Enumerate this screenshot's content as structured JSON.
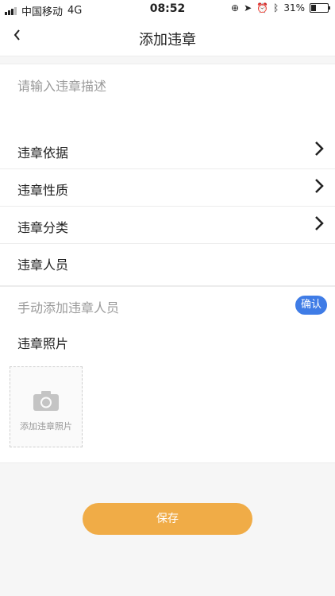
{
  "status_bar": {
    "carrier": "中国移动",
    "network": "4G",
    "time": "08:52",
    "battery_percent": "31%"
  },
  "nav": {
    "back_icon": "chevron-left-icon",
    "title": "添加违章"
  },
  "description": {
    "placeholder": "请输入违章描述",
    "value": ""
  },
  "rows": [
    {
      "label": "违章依据",
      "has_chevron": true
    },
    {
      "label": "违章性质",
      "has_chevron": true
    },
    {
      "label": "违章分类",
      "has_chevron": true
    },
    {
      "label": "违章人员",
      "has_chevron": false
    }
  ],
  "manual_add": {
    "placeholder": "手动添加违章人员",
    "confirm_label": "确认",
    "confirm_color": "#3f7ce6"
  },
  "photos": {
    "label": "违章照片",
    "add_caption": "添加违章照片",
    "add_icon": "camera-icon"
  },
  "save_button": {
    "label": "保存",
    "color": "#f0ac47"
  }
}
